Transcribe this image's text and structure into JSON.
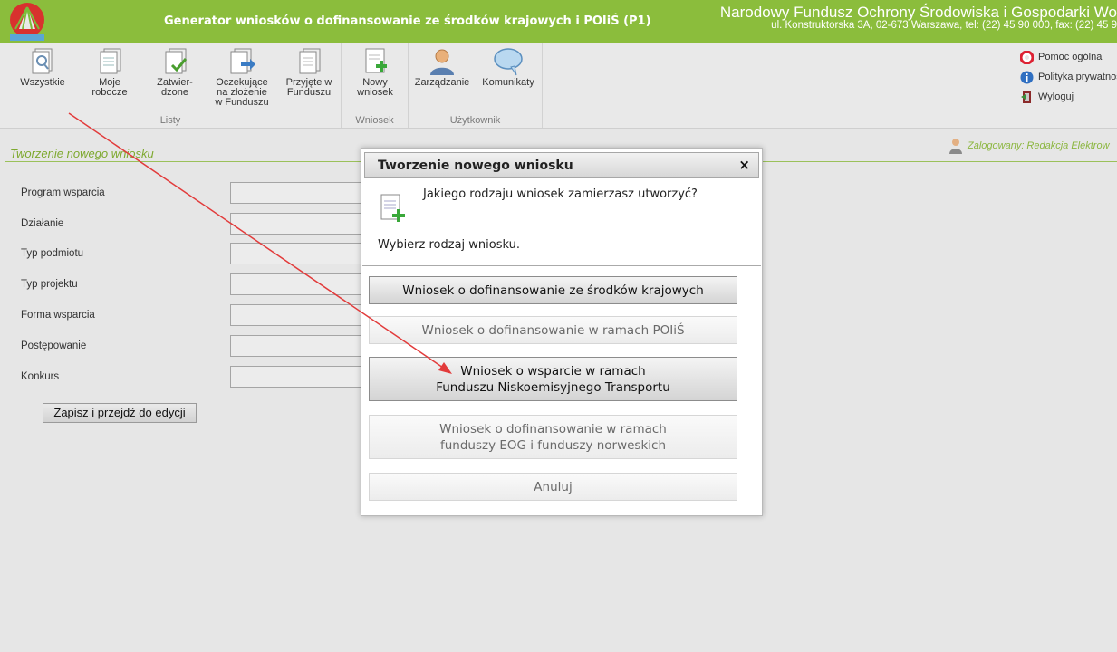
{
  "header": {
    "app_title": "Generator wniosków o dofinansowanie ze środków krajowych i POIiŚ (P1)",
    "org_name": "Narodowy Fundusz Ochrony Środowiska i Gospodarki Wo",
    "org_address": "ul. Konstruktorska 3A, 02-673 Warszawa, tel: (22) 45 90 000, fax: (22) 45 9",
    "logo_text": "SIGEWEB"
  },
  "toolbar": {
    "groups": [
      {
        "label": "Listy"
      },
      {
        "label": "Wniosek"
      },
      {
        "label": "Użytkownik"
      }
    ],
    "buttons": [
      {
        "label": "Wszystkie",
        "icon": "search-doc-icon"
      },
      {
        "label": "Moje\nrobocze",
        "icon": "docs-icon"
      },
      {
        "label": "Zatwier-\ndzone",
        "icon": "approved-doc-icon"
      },
      {
        "label": "Oczekujące\nna złożenie\nw Funduszu",
        "icon": "send-doc-icon"
      },
      {
        "label": "Przyjęte w\nFunduszu",
        "icon": "accepted-doc-icon"
      },
      {
        "label": "Nowy\nwniosek",
        "icon": "new-doc-icon"
      },
      {
        "label": "Zarządzanie",
        "icon": "user-icon"
      },
      {
        "label": "Komunikaty",
        "icon": "speech-bubble-icon"
      }
    ],
    "side_links": [
      {
        "label": "Pomoc ogólna",
        "icon": "lifebuoy-icon"
      },
      {
        "label": "Polityka prywatności",
        "icon": "info-icon"
      },
      {
        "label": "Wyloguj",
        "icon": "logout-icon"
      }
    ]
  },
  "page": {
    "section_title": "Tworzenie nowego wniosku",
    "logged_in": "Zalogowany: Redakcja Elektrow",
    "form_fields": [
      {
        "label": "Program wsparcia",
        "value": ""
      },
      {
        "label": "Działanie",
        "value": ""
      },
      {
        "label": "Typ podmiotu",
        "value": ""
      },
      {
        "label": "Typ projektu",
        "value": ""
      },
      {
        "label": "Forma wsparcia",
        "value": ""
      },
      {
        "label": "Postępowanie",
        "value": ""
      },
      {
        "label": "Konkurs",
        "value": ""
      }
    ],
    "save_label": "Zapisz i przejdź do edycji"
  },
  "modal": {
    "title": "Tworzenie nowego wniosku",
    "close": "×",
    "question": "Jakiego rodzaju wniosek zamierzasz utworzyć?",
    "hint": "Wybierz rodzaj wniosku.",
    "options": [
      {
        "label": "Wniosek o dofinansowanie ze środków krajowych",
        "state": "active"
      },
      {
        "label": "Wniosek o dofinansowanie w ramach POIiŚ",
        "state": "disabled"
      },
      {
        "label": "Wniosek o wsparcie w ramach\nFunduszu Niskoemisyjnego Transportu",
        "state": "active"
      },
      {
        "label": "Wniosek o dofinansowanie w ramach\nfunduszy EOG i funduszy norweskich",
        "state": "disabled"
      },
      {
        "label": "Anuluj",
        "state": "disabled"
      }
    ]
  },
  "colors": {
    "header_green": "#8bbd3c",
    "annotation_arrow": "#e23b3b"
  }
}
